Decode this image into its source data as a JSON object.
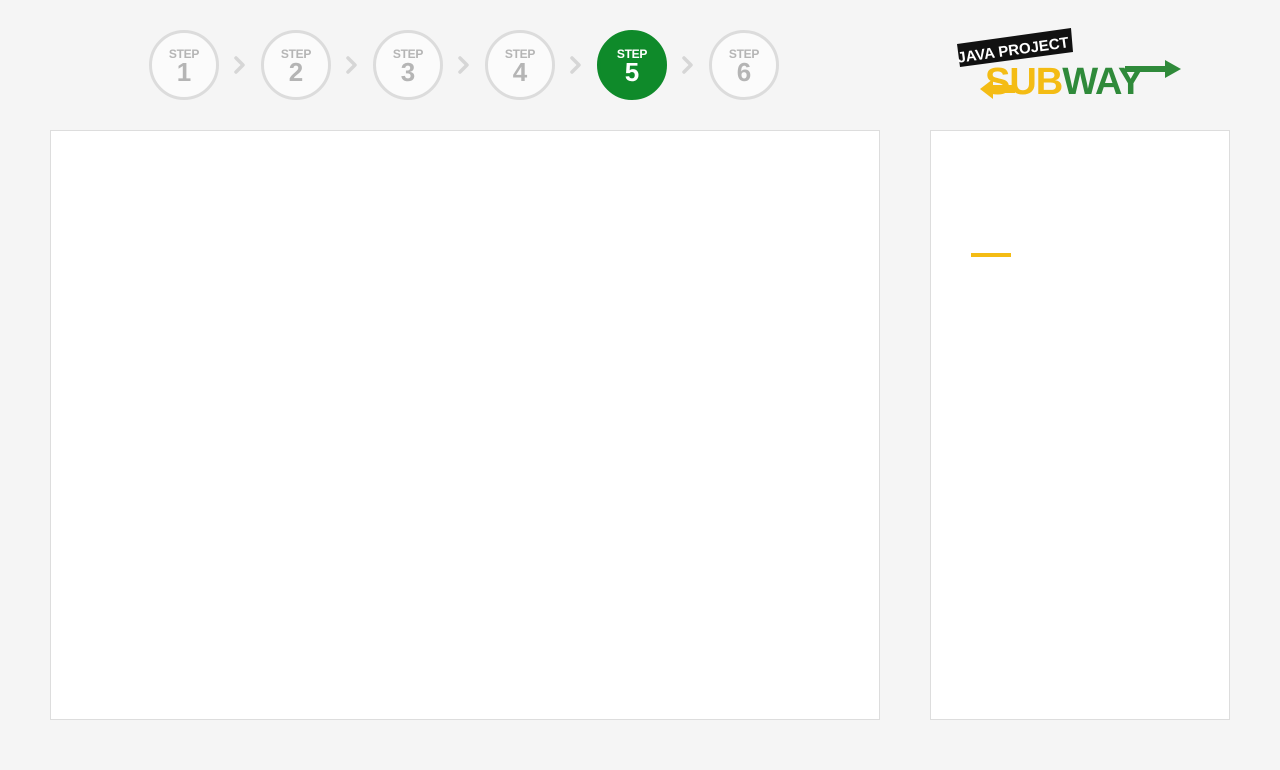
{
  "steps": [
    {
      "label": "STEP",
      "number": "1",
      "active": false
    },
    {
      "label": "STEP",
      "number": "2",
      "active": false
    },
    {
      "label": "STEP",
      "number": "3",
      "active": false
    },
    {
      "label": "STEP",
      "number": "4",
      "active": false
    },
    {
      "label": "STEP",
      "number": "5",
      "active": true
    },
    {
      "label": "STEP",
      "number": "6",
      "active": false
    }
  ],
  "logo": {
    "tagline": "JAVA PROJECT",
    "brand_yellow": "SUB",
    "brand_green": "WAY"
  },
  "colors": {
    "active_step": "#0f8a2a",
    "inactive_step": "#dcdcdc",
    "accent": "#f4bc14",
    "brand_yellow": "#f4bc14",
    "brand_green": "#2f8a3a",
    "background": "#f5f5f5"
  }
}
